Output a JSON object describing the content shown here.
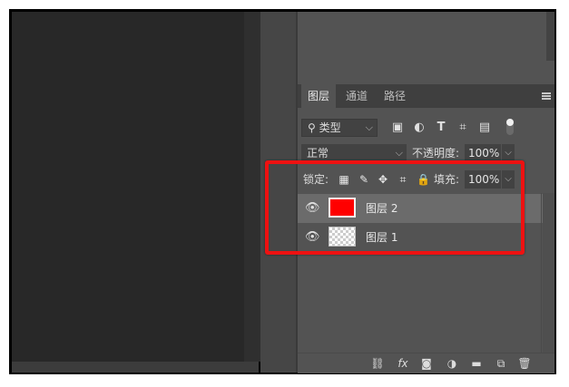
{
  "panel": {
    "tabs": [
      {
        "label": "图层",
        "active": true
      },
      {
        "label": "通道",
        "active": false
      },
      {
        "label": "路径",
        "active": false
      }
    ],
    "menu_icon": "panel-menu-icon",
    "filter": {
      "kind_label": "类型",
      "search_icon": "search-icon",
      "icons": [
        "image-filter-icon",
        "adjustment-filter-icon",
        "type-filter-icon",
        "shape-filter-icon",
        "smart-object-filter-icon"
      ],
      "toggle_on": true
    },
    "blend": {
      "mode": "正常",
      "opacity_label": "不透明度:",
      "opacity_value": "100%"
    },
    "lock": {
      "label": "锁定:",
      "icons": [
        "lock-transparent-pixels-icon",
        "lock-image-pixels-icon",
        "lock-position-icon",
        "lock-artboard-icon",
        "lock-all-icon"
      ],
      "fill_label": "填充:",
      "fill_value": "100%"
    },
    "layers": [
      {
        "name": "图层 2",
        "selected": true,
        "visible": true,
        "thumb": "red",
        "thumb_color": "#ff0000"
      },
      {
        "name": "图层 1",
        "selected": false,
        "visible": true,
        "thumb": "transparent"
      }
    ],
    "bottom_icons": [
      "link-layers-icon",
      "layer-style-fx-icon",
      "add-mask-icon",
      "adjustment-layer-icon",
      "new-group-icon",
      "new-layer-icon",
      "delete-layer-icon"
    ],
    "fx_label": "fx"
  },
  "colors": {
    "highlight": "#ee1111",
    "panel_bg": "#535353",
    "canvas_bg": "#282828",
    "selected_layer": "#6b6b6b"
  }
}
